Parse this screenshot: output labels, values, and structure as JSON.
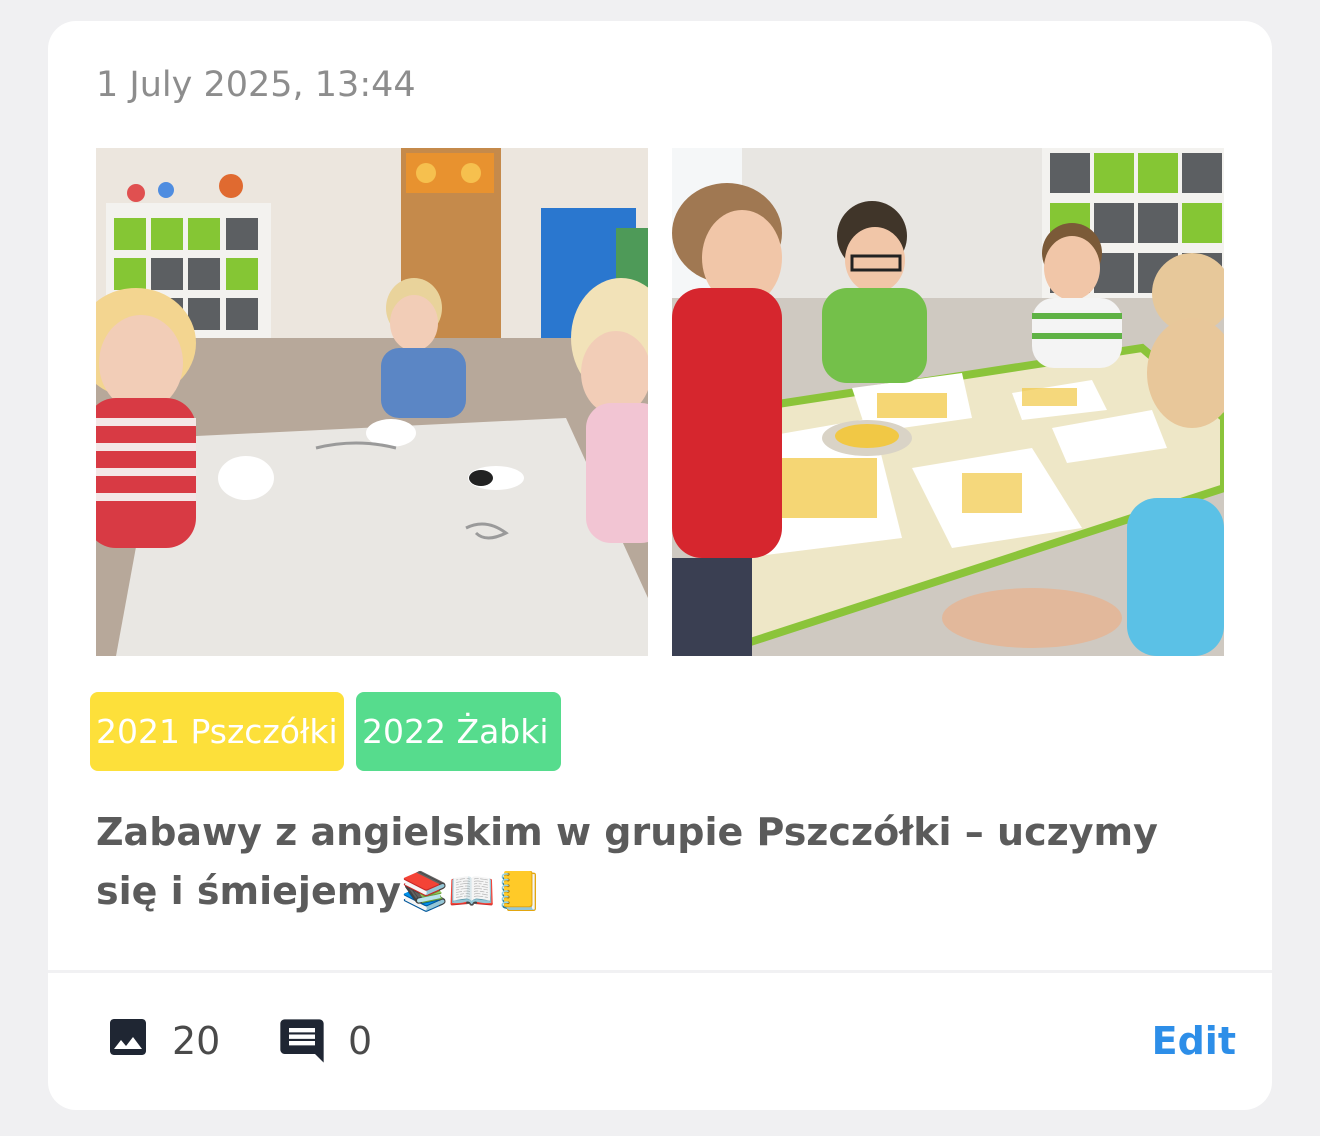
{
  "post": {
    "date": "1 July 2025, 13:44",
    "title": "Zabawy z angielskim w grupie Pszczółki – uczymy się i śmiejemy📚📖📒",
    "tags": [
      {
        "label": "2021 Pszczółki",
        "color": "#fde03a"
      },
      {
        "label": "2022 Żabki",
        "color": "#56dc8d"
      }
    ],
    "photos": [
      {
        "name": "photo-kids-threading-paper-shapes"
      },
      {
        "name": "photo-kids-gluing-yellow-pieces"
      }
    ],
    "footer": {
      "photos_count": "20",
      "comments_count": "0",
      "edit_label": "Edit",
      "photos_icon": "image-icon",
      "comments_icon": "comment-icon"
    },
    "colors": {
      "accent": "#2d8ee8",
      "icon": "#1f2633"
    }
  }
}
